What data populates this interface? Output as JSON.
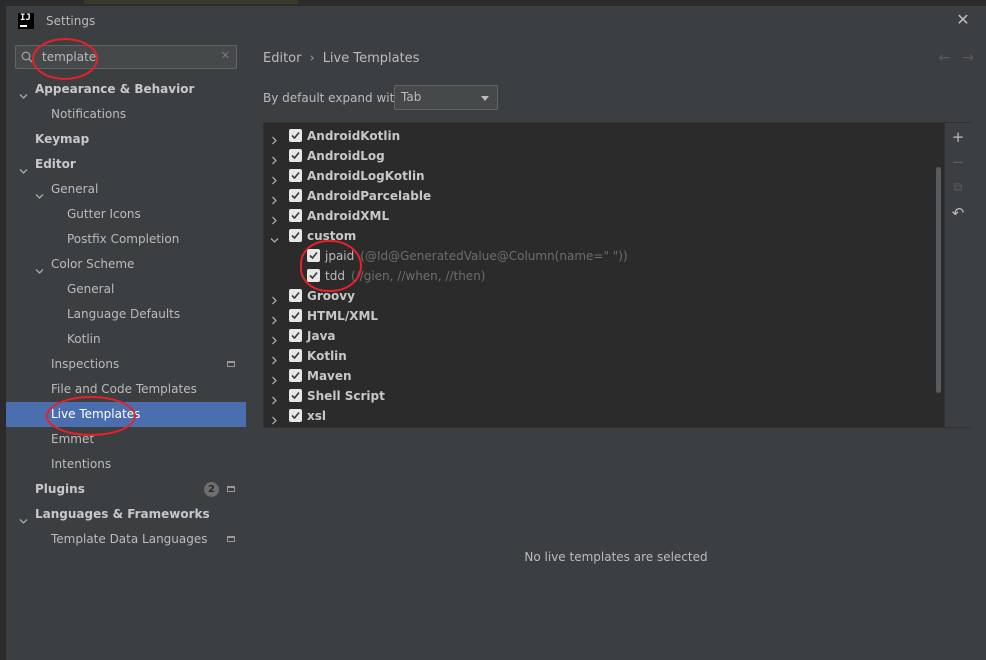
{
  "window": {
    "title": "Settings"
  },
  "search": {
    "value": "template",
    "placeholder": ""
  },
  "sidebar": {
    "items": [
      {
        "label": "Appearance & Behavior",
        "level": 0,
        "bold": true,
        "expanded": true,
        "icon": "chevron-down-icon"
      },
      {
        "label": "Notifications",
        "level": 1
      },
      {
        "label": "Keymap",
        "level": 0,
        "bold": true
      },
      {
        "label": "Editor",
        "level": 0,
        "bold": true,
        "expanded": true,
        "icon": "chevron-down-icon"
      },
      {
        "label": "General",
        "level": 1,
        "expanded": true,
        "icon": "chevron-down-icon"
      },
      {
        "label": "Gutter Icons",
        "level": 2
      },
      {
        "label": "Postfix Completion",
        "level": 2
      },
      {
        "label": "Color Scheme",
        "level": 1,
        "expanded": true,
        "icon": "chevron-down-icon"
      },
      {
        "label": "General",
        "level": 2
      },
      {
        "label": "Language Defaults",
        "level": 2
      },
      {
        "label": "Kotlin",
        "level": 2
      },
      {
        "label": "Inspections",
        "level": 1,
        "side_icon": "project-scope-icon"
      },
      {
        "label": "File and Code Templates",
        "level": 1
      },
      {
        "label": "Live Templates",
        "level": 1,
        "selected": true
      },
      {
        "label": "Emmet",
        "level": 1
      },
      {
        "label": "Intentions",
        "level": 1
      },
      {
        "label": "Plugins",
        "level": 0,
        "bold": true,
        "badge": "2",
        "side_icon": "project-scope-icon"
      },
      {
        "label": "Languages & Frameworks",
        "level": 0,
        "bold": true,
        "expanded": true,
        "icon": "chevron-down-icon"
      },
      {
        "label": "Template Data Languages",
        "level": 1,
        "side_icon": "project-scope-icon"
      }
    ]
  },
  "breadcrumb": {
    "parent": "Editor",
    "current": "Live Templates",
    "separator": "›"
  },
  "nav": {
    "back": "←",
    "forward": "→"
  },
  "expand": {
    "label": "By default expand with",
    "value": "Tab"
  },
  "templates": [
    {
      "name": "AndroidKotlin",
      "checked": true,
      "expanded": false
    },
    {
      "name": "AndroidLog",
      "checked": true,
      "expanded": false
    },
    {
      "name": "AndroidLogKotlin",
      "checked": true,
      "expanded": false
    },
    {
      "name": "AndroidParcelable",
      "checked": true,
      "expanded": false
    },
    {
      "name": "AndroidXML",
      "checked": true,
      "expanded": false
    },
    {
      "name": "custom",
      "checked": true,
      "expanded": true,
      "children": [
        {
          "name": "jpaid",
          "checked": true,
          "description": "(@Id@GeneratedValue@Column(name=\"  \"))"
        },
        {
          "name": "tdd",
          "checked": true,
          "description": "(//gien, //when, //then)"
        }
      ]
    },
    {
      "name": "Groovy",
      "checked": true,
      "expanded": false
    },
    {
      "name": "HTML/XML",
      "checked": true,
      "expanded": false
    },
    {
      "name": "Java",
      "checked": true,
      "expanded": false
    },
    {
      "name": "Kotlin",
      "checked": true,
      "expanded": false
    },
    {
      "name": "Maven",
      "checked": true,
      "expanded": false
    },
    {
      "name": "Shell Script",
      "checked": true,
      "expanded": false
    },
    {
      "name": "xsl",
      "checked": true,
      "expanded": false
    }
  ],
  "toolbar": {
    "add": {
      "glyph": "+",
      "icon": "add-icon",
      "enabled": true
    },
    "remove": {
      "glyph": "−",
      "icon": "remove-icon",
      "enabled": false
    },
    "copy": {
      "glyph": "⧉",
      "icon": "copy-icon",
      "enabled": false
    },
    "restore": {
      "glyph": "↶",
      "icon": "restore-icon",
      "enabled": true
    }
  },
  "empty_message": "No live templates are selected",
  "colors": {
    "selection": "#4b6eaf",
    "annotation": "#e8202a",
    "background": "#3c3f41",
    "list_bg": "#2b2b2b"
  }
}
